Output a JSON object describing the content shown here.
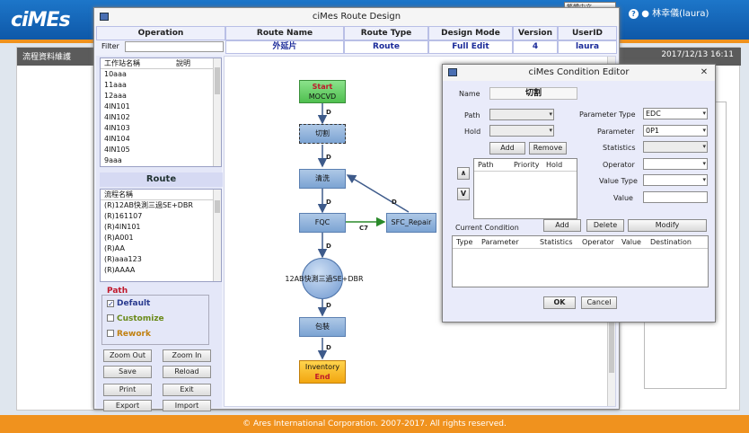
{
  "app": {
    "logo": "ciMEs",
    "user": "林幸儀(laura)",
    "lang_select": "繁體中文"
  },
  "page": {
    "title": "流程資料維護",
    "datetime": "2017/12/13 16:11"
  },
  "footer": "© Ares International Corporation. 2007-2017. All rights reserved.",
  "route_design": {
    "title": "ciMes Route Design",
    "headers": {
      "operation": "Operation",
      "route_name": "Route  Name",
      "route_type": "Route Type",
      "design_mode": "Design Mode",
      "version": "Version",
      "userid": "UserID"
    },
    "values": {
      "route_name": "外延片",
      "route_type": "Route",
      "design_mode": "Full Edit",
      "version": "4",
      "userid": "laura"
    },
    "filter_label": "Filter",
    "op_list": {
      "col1": "工作站名稱",
      "col2": "說明",
      "items": [
        "10aaa",
        "11aaa",
        "12aaa",
        "4IN101",
        "4IN102",
        "4IN103",
        "4IN104",
        "4IN105",
        "9aaa"
      ]
    },
    "route_section": "Route",
    "route_list": {
      "col1": "流程名稱",
      "items": [
        "(R)12AB快測三過SE+DBR",
        "(R)161107",
        "(R)4IN101",
        "(R)A001",
        "(R)AA",
        "(R)aaa123",
        "(R)AAAA"
      ]
    },
    "path_title": "Path",
    "checks": {
      "default": "Default",
      "customize": "Customize",
      "rework": "Rework"
    },
    "buttons": {
      "zoom_out": "Zoom Out",
      "zoom_in": "Zoom In",
      "save": "Save",
      "reload": "Reload",
      "print": "Print",
      "exit": "Exit",
      "export": "Export",
      "import": "Import"
    },
    "flow": {
      "start_top": "Start",
      "start_bottom": "MOCVD",
      "cut": "切割",
      "wash": "清洗",
      "fqc": "FQC",
      "repair": "SFC_Repair",
      "circle": "12AB快測三過SE+DBR",
      "pack": "包裝",
      "end_top": "Inventory",
      "end_bottom": "End",
      "edge_d": "D",
      "edge_c7": "C7"
    }
  },
  "condition_editor": {
    "title": "ciMes Condition Editor",
    "name_label": "Name",
    "name_value": "切割",
    "path_label": "Path",
    "hold_label": "Hold",
    "add": "Add",
    "remove": "Remove",
    "up": "∧",
    "down": "V",
    "path_table": {
      "path": "Path",
      "priority": "Priority",
      "hold": "Hold"
    },
    "param_type_label": "Parameter Type",
    "param_type_value": "EDC",
    "parameter_label": "Parameter",
    "parameter_value": "0P1",
    "statistics_label": "Statistics",
    "operator_label": "Operator",
    "value_type_label": "Value Type",
    "value_label": "Value",
    "current_condition": "Current Condition",
    "cc_add": "Add",
    "cc_delete": "Delete",
    "cc_modify": "Modify",
    "cc_headers": {
      "type": "Type",
      "parameter": "Parameter",
      "statistics": "Statistics",
      "operator": "Operator",
      "value": "Value",
      "destination": "Destination"
    },
    "ok": "OK",
    "cancel": "Cancel"
  }
}
